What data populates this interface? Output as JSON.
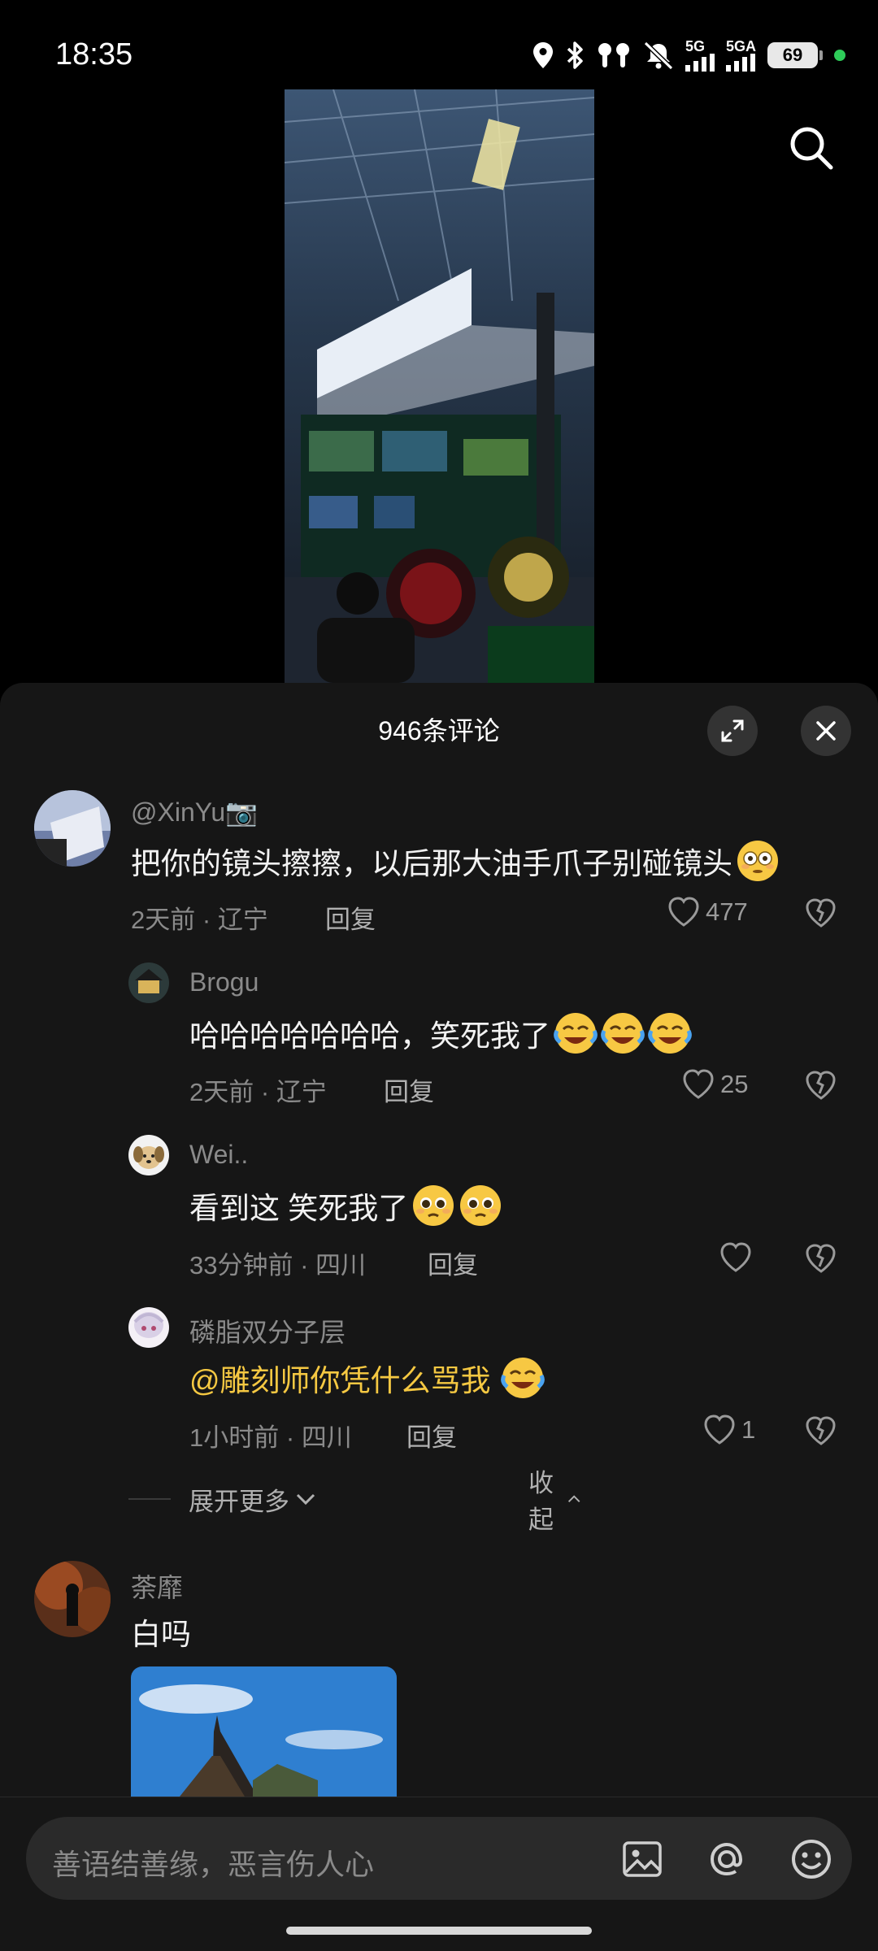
{
  "status_bar": {
    "time": "18:35",
    "signal1_label": "5G",
    "signal2_label": "5GA",
    "battery": "69",
    "icons": [
      "location-icon",
      "bluetooth-icon",
      "earbuds-icon",
      "mute-icon",
      "signal-icon",
      "battery-icon"
    ]
  },
  "video": {
    "search_icon": "search-icon"
  },
  "sheet": {
    "title": "946条评论",
    "expand_icon": "expand-icon",
    "close_icon": "close-icon"
  },
  "comments": [
    {
      "user": "@XinYu📷",
      "text": "把你的镜头擦擦，以后那大油手爪子别碰镜头",
      "emoji": "flushed-face",
      "time": "2天前",
      "location": "辽宁",
      "reply_label": "回复",
      "likes": "477"
    },
    {
      "user": "Brogu",
      "text": "哈哈哈哈哈哈哈，笑死我了",
      "emoji": "laughing-crying-face x3",
      "time": "2天前",
      "location": "辽宁",
      "reply_label": "回复",
      "likes": "25"
    },
    {
      "user": "Wei..",
      "text": "看到这 笑死我了",
      "emoji": "pleading-face x2",
      "time": "33分钟前",
      "location": "四川",
      "reply_label": "回复",
      "likes": ""
    },
    {
      "user": "磷脂双分子层",
      "text": "@雕刻师你凭什么骂我",
      "emoji": "laughing-crying-face",
      "time": "1小时前",
      "location": "四川",
      "reply_label": "回复",
      "likes": "1"
    },
    {
      "user": "荼靡",
      "text": "白吗"
    }
  ],
  "thread_controls": {
    "expand_more": "展开更多",
    "collapse": "收起"
  },
  "input": {
    "placeholder": "善语结善缘，恶言伤人心",
    "icons": [
      "image-icon",
      "at-icon",
      "emoji-icon"
    ]
  },
  "colors": {
    "sheet_bg": "#161616",
    "mention": "#f5c842",
    "meta": "#8a8a8a"
  }
}
